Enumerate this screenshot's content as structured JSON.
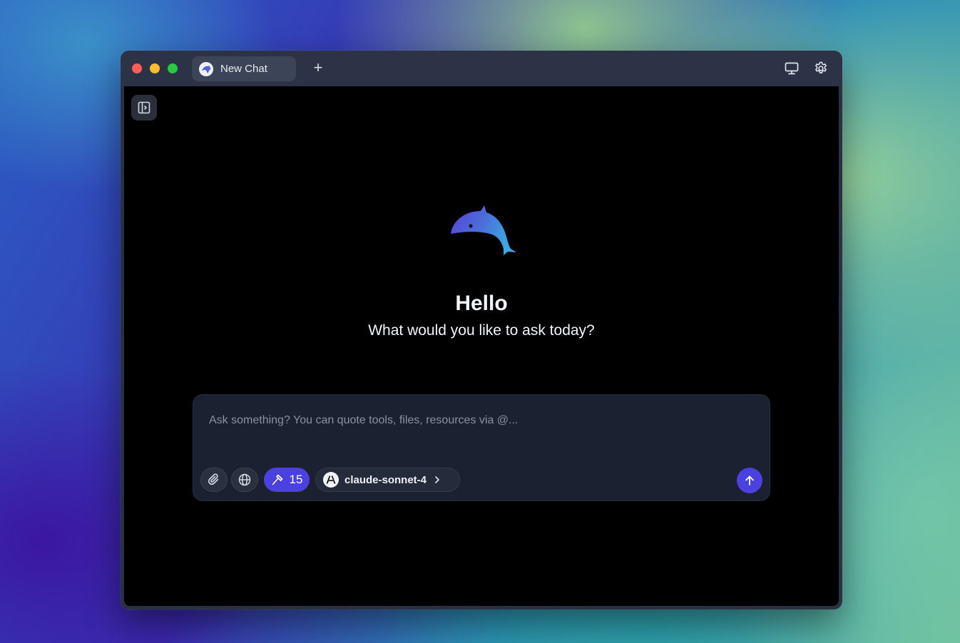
{
  "window": {
    "traffic_lights": [
      "close",
      "minimize",
      "zoom"
    ]
  },
  "tabs": [
    {
      "label": "New Chat",
      "icon": "dolphin-icon"
    }
  ],
  "titlebar": {
    "new_tab_label": "+",
    "right_icons": [
      "monitor-icon",
      "gear-icon"
    ]
  },
  "sidebar_toggle": {
    "icon": "sidebar-toggle-icon"
  },
  "main": {
    "greeting": "Hello",
    "subtitle": "What would you like to ask today?"
  },
  "composer": {
    "placeholder": "Ask something? You can quote tools, files, resources via @...",
    "value": "",
    "attach_icon": "paperclip-icon",
    "web_icon": "globe-icon",
    "tools_count": "15",
    "tools_icon": "hammer-icon",
    "model_name": "claude-sonnet-4",
    "model_icon": "anthropic-icon",
    "send_icon": "arrow-up-icon"
  },
  "colors": {
    "accent": "#4a41e0",
    "content_bg": "#000000",
    "composer_bg": "#1b2130",
    "titlebar_bg": "#2c3346"
  }
}
